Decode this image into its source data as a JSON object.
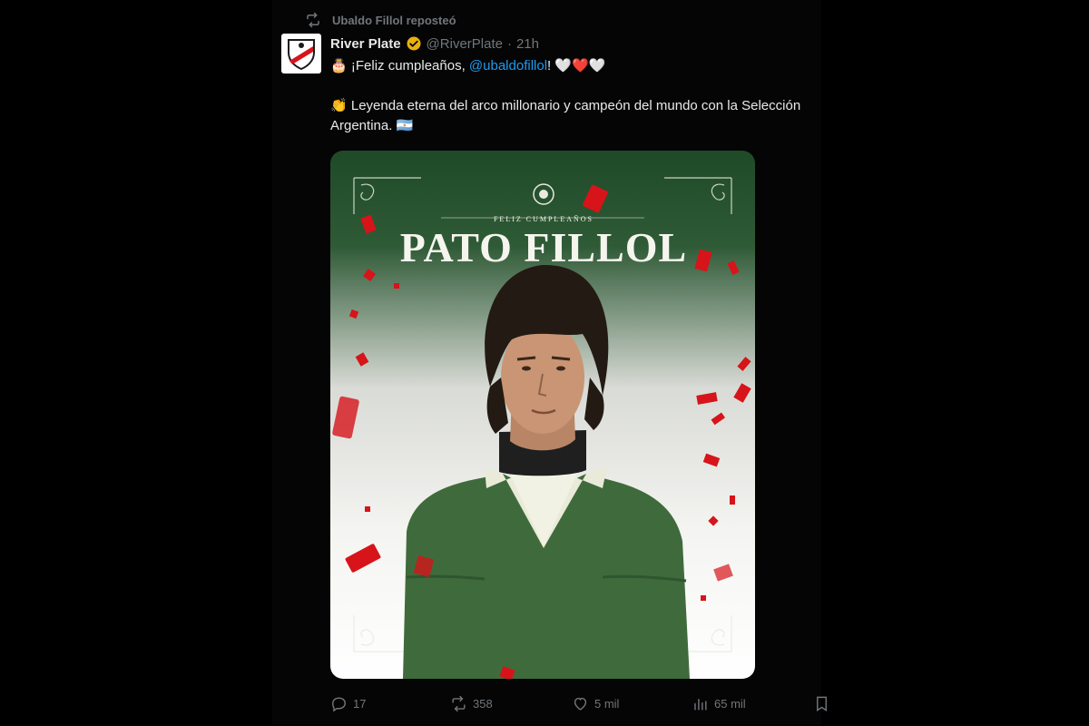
{
  "repost": {
    "text": "Ubaldo Fillol reposteó",
    "icon": "repost-icon"
  },
  "tweet": {
    "author": {
      "display_name": "River Plate",
      "handle": "@RiverPlate",
      "separator": "·",
      "time": "21h",
      "verified_color": "#e8b10d",
      "avatar_icon": "river-plate-crest"
    },
    "text": {
      "cake_emoji": "🎂",
      "greeting": "¡Feliz cumpleaños, ",
      "mention": "@ubaldofillol",
      "exclaim": "!",
      "hearts": [
        "🤍",
        "❤️",
        "🤍"
      ],
      "emoji_2": "👏",
      "line_2": "Leyenda eterna del arco millonario y campeón del mundo con la Selección Argentina.",
      "flag_emoji": "🇦🇷"
    },
    "media": {
      "subtitle": "FELIZ CUMPLEAÑOS",
      "title": "PATO FILLOL",
      "confetti_color": "#d6141a"
    },
    "actions": {
      "replies": "17",
      "reposts": "358",
      "likes": "5 mil",
      "views": "65 mil"
    }
  }
}
